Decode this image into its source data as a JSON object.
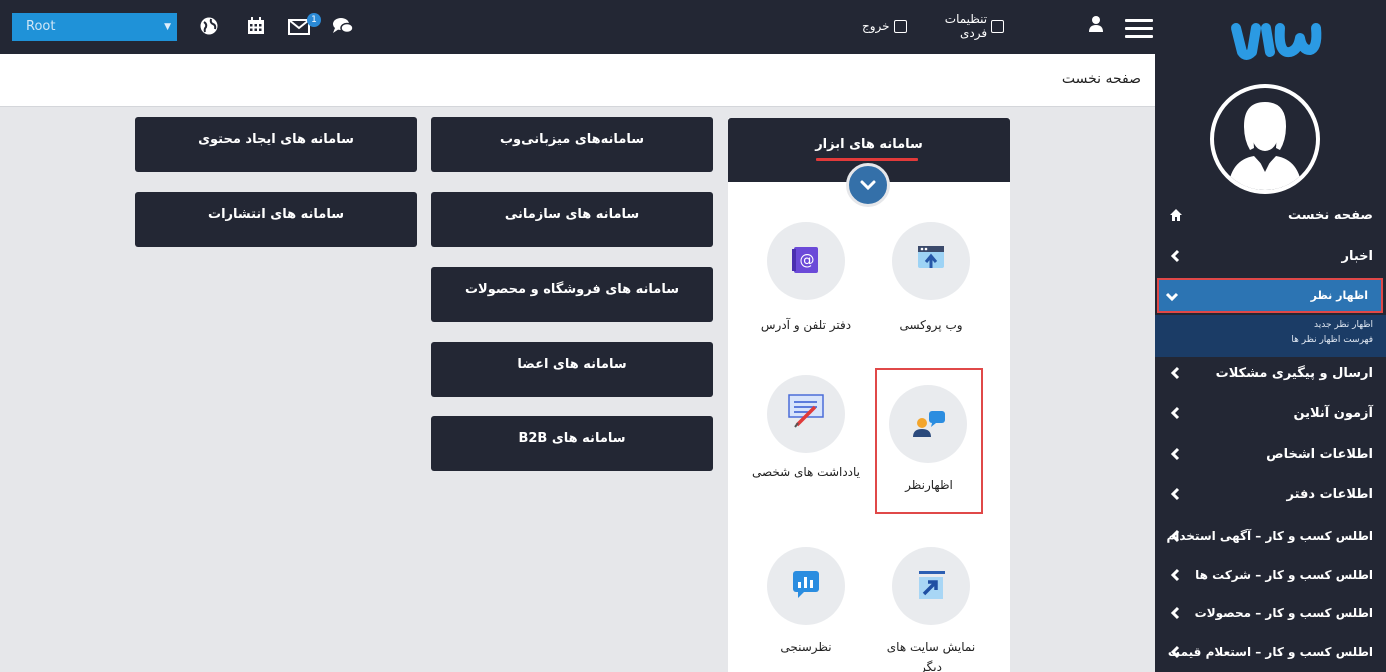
{
  "topbar": {
    "root_select": {
      "value": "Root"
    },
    "icons": [
      "globe-icon",
      "calendar-icon",
      "mail-icon",
      "chat-icon"
    ],
    "mail_badge": "1",
    "settings_label": "تنظیمات فردی",
    "logout_label": "خروج"
  },
  "breadcrumb": {
    "title": "صفحه نخست"
  },
  "sidebar": {
    "items": [
      {
        "label": "صفحه نخست",
        "icon": "home-icon"
      },
      {
        "label": "اخبار",
        "icon": "chevron-left-icon"
      },
      {
        "label": "اظهار نظر",
        "icon": "chevron-down-icon"
      },
      {
        "label": "ارسال و پیگیری مشکلات",
        "icon": "chevron-left-icon"
      },
      {
        "label": "آزمون آنلاین",
        "icon": "chevron-left-icon"
      },
      {
        "label": "اطلاعات اشخاص",
        "icon": "chevron-left-icon"
      },
      {
        "label": "اطلاعات دفتر",
        "icon": "chevron-left-icon"
      },
      {
        "label": "اطلس کسب و کار – آگهی استخدام",
        "icon": "chevron-left-icon"
      },
      {
        "label": "اطلس کسب و کار – شرکت ها",
        "icon": "chevron-left-icon"
      },
      {
        "label": "اطلس کسب و کار – محصولات",
        "icon": "chevron-left-icon"
      },
      {
        "label": "اطلس کسب و کار – استعلام قیمت",
        "icon": "chevron-left-icon"
      }
    ],
    "submenu": [
      "اظهار نظر جدید",
      "فهرست اظهار نظر ها"
    ]
  },
  "tiles": {
    "content": "سامانه های ایجاد محتوی",
    "hosting": "سامانه‌های میزبانی‌وب",
    "publications": "سامانه های انتشارات",
    "organizational": "سامانه های سازمانی",
    "shop": "سامانه های فروشگاه و محصولات",
    "members": "سامانه های اعضا",
    "b2b": "سامانه های B2B"
  },
  "tools": {
    "title": "سامانه های ابزار",
    "items": [
      {
        "label": "وب پروکسی",
        "icon": "web-proxy-icon"
      },
      {
        "label": "دفتر تلفن و آدرس",
        "icon": "address-book-icon"
      },
      {
        "label": "اظهارنظر",
        "icon": "feedback-icon"
      },
      {
        "label": "یادداشت های شخصی",
        "icon": "notes-icon"
      },
      {
        "label": "نمایش سایت های دیگر",
        "icon": "external-site-icon"
      },
      {
        "label": "نظرسنجی",
        "icon": "poll-icon"
      }
    ]
  },
  "colors": {
    "dark": "#232734",
    "blue": "#1f92d8",
    "active_menu": "#2c74b3",
    "highlight": "#e04848"
  }
}
